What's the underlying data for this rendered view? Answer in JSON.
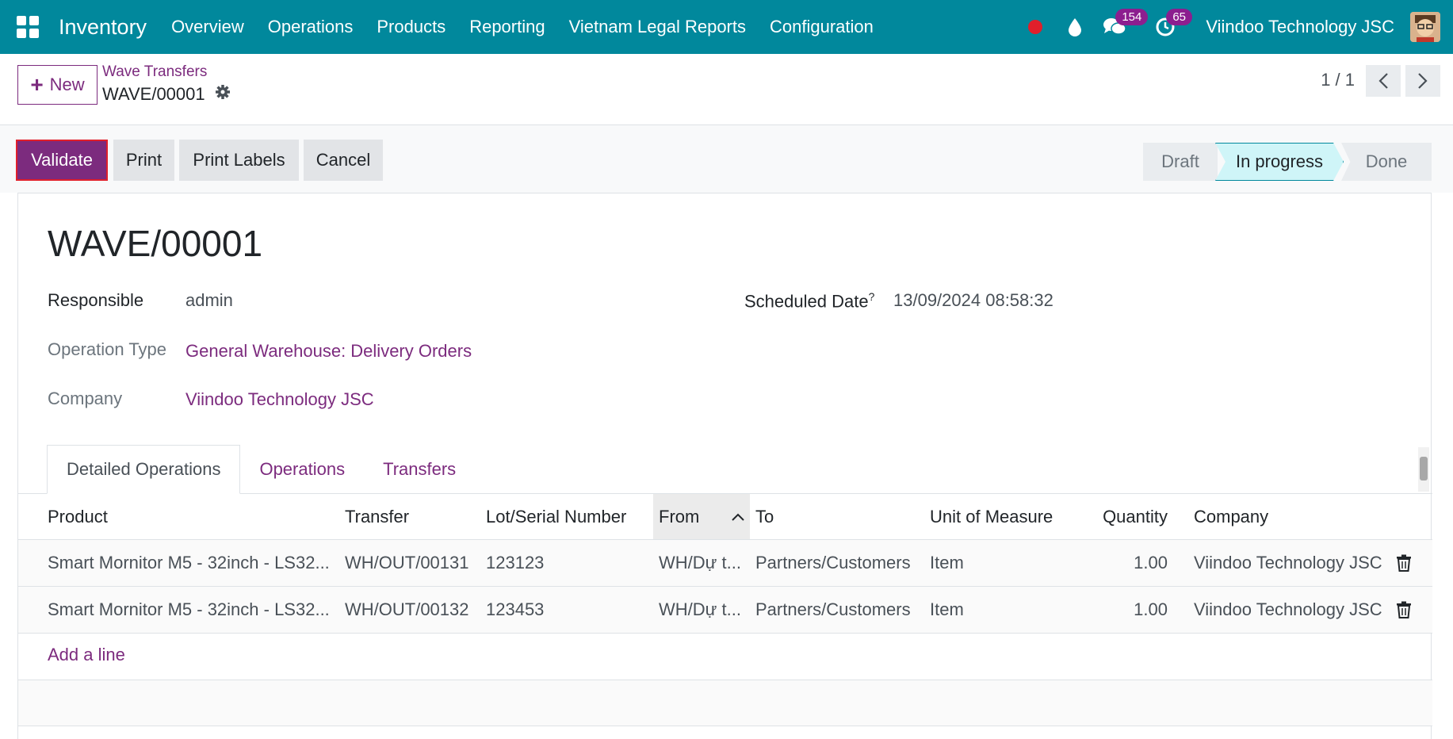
{
  "navbar": {
    "app_name": "Inventory",
    "menu": [
      "Overview",
      "Operations",
      "Products",
      "Reporting",
      "Vietnam Legal Reports",
      "Configuration"
    ],
    "messages_count": "154",
    "activities_count": "65",
    "company": "Viindoo Technology JSC"
  },
  "control_panel": {
    "new_label": "New",
    "breadcrumb": "Wave Transfers",
    "record_name": "WAVE/00001",
    "pager": "1 / 1"
  },
  "actions": {
    "validate": "Validate",
    "print": "Print",
    "print_labels": "Print Labels",
    "cancel": "Cancel"
  },
  "stages": {
    "draft": "Draft",
    "in_progress": "In progress",
    "done": "Done",
    "current": "In progress"
  },
  "form": {
    "title": "WAVE/00001",
    "responsible_label": "Responsible",
    "responsible": "admin",
    "scheduled_date_label": "Scheduled Date",
    "scheduled_date_help": "?",
    "scheduled_date": "13/09/2024 08:58:32",
    "operation_type_label": "Operation Type",
    "operation_type": "General Warehouse: Delivery Orders",
    "company_label": "Company",
    "company": "Viindoo Technology JSC"
  },
  "tabs": {
    "detailed_operations": "Detailed Operations",
    "operations": "Operations",
    "transfers": "Transfers"
  },
  "table": {
    "columns": {
      "product": "Product",
      "transfer": "Transfer",
      "lot": "Lot/Serial Number",
      "from": "From",
      "to": "To",
      "uom": "Unit of Measure",
      "quantity": "Quantity",
      "company": "Company"
    },
    "rows": [
      {
        "product": "Smart Mornitor M5 - 32inch - LS32...",
        "transfer": "WH/OUT/00131",
        "lot": "123123",
        "from": "WH/Dự t...",
        "to": "Partners/Customers",
        "uom": "Item",
        "quantity": "1.00",
        "company": "Viindoo Technology JSC"
      },
      {
        "product": "Smart Mornitor M5 - 32inch - LS32...",
        "transfer": "WH/OUT/00132",
        "lot": "123453",
        "from": "WH/Dự t...",
        "to": "Partners/Customers",
        "uom": "Item",
        "quantity": "1.00",
        "company": "Viindoo Technology JSC"
      }
    ],
    "add_line": "Add a line"
  },
  "colors": {
    "navbar": "#01889c",
    "primary": "#7c2b7e",
    "badge": "#8c1e8f",
    "recording": "#e01f2b",
    "stage_active": "#cff5f8"
  }
}
